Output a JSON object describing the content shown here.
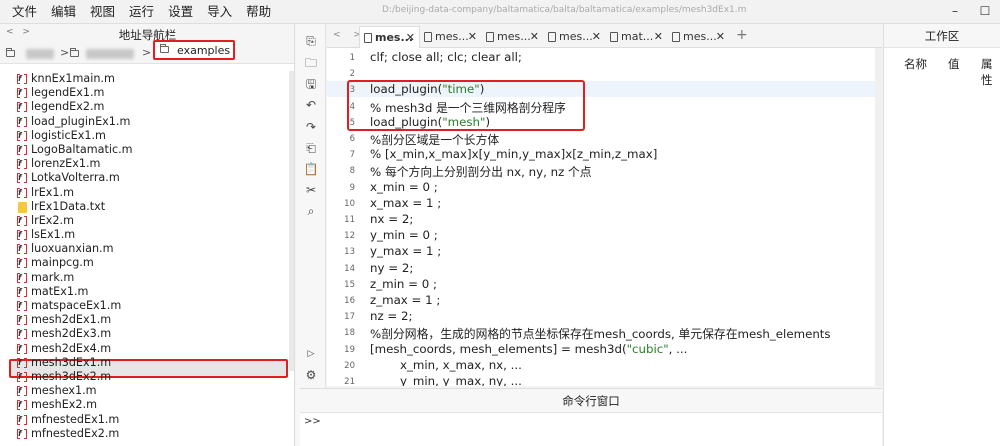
{
  "menubar": {
    "items": [
      "文件",
      "编辑",
      "视图",
      "运行",
      "设置",
      "导入",
      "帮助"
    ],
    "path": "D:/beijing-data-company/baltamatica/balta/baltamatica/examples/mesh3dEx1.m",
    "minimize": "–",
    "maximize": "☐"
  },
  "navigator": {
    "title": "地址导航栏",
    "arrows": "< >",
    "breadcrumb_active": "examples",
    "files": [
      {
        "name": "knnEx1main.m",
        "type": "m"
      },
      {
        "name": "legendEx1.m",
        "type": "m"
      },
      {
        "name": "legendEx2.m",
        "type": "m"
      },
      {
        "name": "load_pluginEx1.m",
        "type": "m"
      },
      {
        "name": "logisticEx1.m",
        "type": "m"
      },
      {
        "name": "LogoBaltamatic.m",
        "type": "m"
      },
      {
        "name": "lorenzEx1.m",
        "type": "m"
      },
      {
        "name": "LotkaVolterra.m",
        "type": "m"
      },
      {
        "name": "lrEx1.m",
        "type": "m"
      },
      {
        "name": "lrEx1Data.txt",
        "type": "txt"
      },
      {
        "name": "lrEx2.m",
        "type": "m"
      },
      {
        "name": "lsEx1.m",
        "type": "m"
      },
      {
        "name": "luoxuanxian.m",
        "type": "m"
      },
      {
        "name": "mainpcg.m",
        "type": "m"
      },
      {
        "name": "mark.m",
        "type": "m"
      },
      {
        "name": "matEx1.m",
        "type": "m"
      },
      {
        "name": "matspaceEx1.m",
        "type": "m"
      },
      {
        "name": "mesh2dEx1.m",
        "type": "m"
      },
      {
        "name": "mesh2dEx3.m",
        "type": "m"
      },
      {
        "name": "mesh2dEx4.m",
        "type": "m"
      },
      {
        "name": "mesh3dEx1.m",
        "type": "m",
        "selected": true
      },
      {
        "name": "mesh3dEx2.m",
        "type": "m"
      },
      {
        "name": "meshex1.m",
        "type": "m"
      },
      {
        "name": "meshEx2.m",
        "type": "m"
      },
      {
        "name": "mfnestedEx1.m",
        "type": "m"
      },
      {
        "name": "mfnestedEx2.m",
        "type": "m"
      }
    ]
  },
  "editor": {
    "tab_arrows": "< >",
    "tabs": [
      "mes...",
      "mes...",
      "mes...",
      "mes...",
      "mat...",
      "mes..."
    ],
    "tab_plus": "+",
    "lines": [
      {
        "n": "1",
        "text": "clf; close all; clc; clear all;",
        "kind": "code"
      },
      {
        "n": "2",
        "text": "",
        "kind": "code"
      },
      {
        "n": "3",
        "pre": "load_plugin(",
        "str": "\"time\"",
        "post": ")",
        "kind": "mixed",
        "current": true
      },
      {
        "n": "4",
        "text": "% mesh3d 是一个三维网格剖分程序",
        "kind": "comment"
      },
      {
        "n": "5",
        "pre": "load_plugin(",
        "str": "\"mesh\"",
        "post": ")",
        "kind": "mixed"
      },
      {
        "n": "6",
        "text": "%剖分区域是一个长方体",
        "kind": "comment"
      },
      {
        "n": "7",
        "text": "% [x_min,x_max]x[y_min,y_max]x[z_min,z_max]",
        "kind": "comment"
      },
      {
        "n": "8",
        "text": "% 每个方向上分别剖分出 nx, ny, nz 个点",
        "kind": "comment"
      },
      {
        "n": "9",
        "text": "x_min = 0 ;",
        "kind": "code"
      },
      {
        "n": "10",
        "text": "x_max = 1 ;",
        "kind": "code"
      },
      {
        "n": "11",
        "text": "nx = 2;",
        "kind": "code"
      },
      {
        "n": "12",
        "text": "y_min = 0 ;",
        "kind": "code"
      },
      {
        "n": "13",
        "text": "y_max = 1 ;",
        "kind": "code"
      },
      {
        "n": "14",
        "text": "ny = 2;",
        "kind": "code"
      },
      {
        "n": "15",
        "text": "z_min = 0 ;",
        "kind": "code"
      },
      {
        "n": "16",
        "text": "z_max = 1 ;",
        "kind": "code"
      },
      {
        "n": "17",
        "text": "nz = 2;",
        "kind": "code"
      },
      {
        "n": "18",
        "text": "%剖分网格，生成的网格的节点坐标保存在mesh_coords, 单元保存在mesh_elements",
        "kind": "comment"
      },
      {
        "n": "19",
        "pre": "[mesh_coords, mesh_elements] = mesh3d(",
        "str": "\"cubic\"",
        "post": ",  ...",
        "kind": "mixed"
      },
      {
        "n": "20",
        "text": "        x_min, x_max, nx, ...",
        "kind": "code"
      },
      {
        "n": "21",
        "text": "        y_min, y_max, ny, ...",
        "kind": "code"
      }
    ]
  },
  "command_window": {
    "title": "命令行窗口",
    "prompt": ">>"
  },
  "workspace": {
    "title": "工作区",
    "columns": [
      "名称",
      "值",
      "属性"
    ]
  },
  "colors": {
    "comment": "#2ca02c",
    "highlight_box": "#e02020"
  }
}
